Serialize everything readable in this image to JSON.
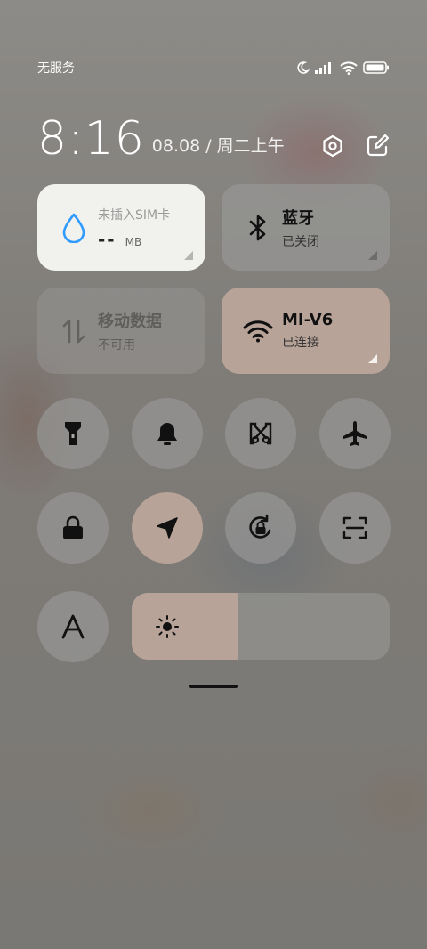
{
  "status_bar": {
    "carrier": "无服务",
    "icons": [
      "moon-icon",
      "signal-icon",
      "wifi-icon",
      "battery-icon"
    ]
  },
  "header": {
    "time": "8:16",
    "date": "08.08 / 周二上午",
    "actions": [
      "settings-icon",
      "edit-icon"
    ]
  },
  "tiles": {
    "data": {
      "title": "未插入SIM卡",
      "value": "--",
      "unit": "MB",
      "icon": "water-drop-icon",
      "accent": "#2f9bff"
    },
    "bluetooth": {
      "title": "蓝牙",
      "subtitle": "已关闭",
      "icon": "bluetooth-icon"
    },
    "mobile_data": {
      "title": "移动数据",
      "subtitle": "不可用",
      "icon": "data-arrows-icon"
    },
    "wifi": {
      "title": "MI-V6",
      "subtitle": "已连接",
      "icon": "wifi-icon"
    }
  },
  "toggles": [
    {
      "name": "flashlight",
      "icon": "flashlight-icon",
      "active": false
    },
    {
      "name": "sound",
      "icon": "bell-icon",
      "active": false
    },
    {
      "name": "screenshot",
      "icon": "scissors-icon",
      "active": false
    },
    {
      "name": "airplane-mode",
      "icon": "airplane-icon",
      "active": false
    },
    {
      "name": "lock-screen",
      "icon": "lock-icon",
      "active": false
    },
    {
      "name": "location",
      "icon": "location-arrow-icon",
      "active": true
    },
    {
      "name": "rotation-lock",
      "icon": "rotation-lock-icon",
      "active": false
    },
    {
      "name": "scanner",
      "icon": "scan-icon",
      "active": false
    },
    {
      "name": "font",
      "icon": "font-a-icon",
      "active": false
    }
  ],
  "brightness": {
    "level_percent": 41,
    "icon": "sun-icon"
  },
  "colors": {
    "active": "#b8a398",
    "tile_light": "#f1f1ee"
  }
}
